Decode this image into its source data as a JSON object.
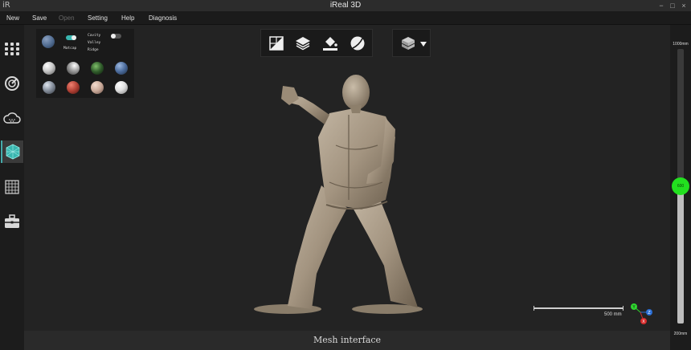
{
  "window": {
    "logo": "iR",
    "title": "iReal 3D",
    "controls": [
      "−",
      "□",
      "×"
    ]
  },
  "menu": [
    {
      "label": "New",
      "enabled": true
    },
    {
      "label": "Save",
      "enabled": true
    },
    {
      "label": "Open",
      "enabled": false
    },
    {
      "label": "Setting",
      "enabled": true
    },
    {
      "label": "Help",
      "enabled": true
    },
    {
      "label": "Diagnosis",
      "enabled": true
    }
  ],
  "sidebar": {
    "items": [
      {
        "name": "grid-dots-icon",
        "active": false
      },
      {
        "name": "scan-target-icon",
        "active": false
      },
      {
        "name": "cloud-icon",
        "active": false
      },
      {
        "name": "mesh-cube-icon",
        "active": true
      },
      {
        "name": "texture-grid-icon",
        "active": false
      },
      {
        "name": "toolbox-icon",
        "active": false
      }
    ]
  },
  "material_panel": {
    "matcap_label": "Matcap",
    "options": [
      "Cavity",
      "Valley",
      "Ridge"
    ],
    "colors": {
      "preview": "#4f6a8f",
      "matcaps": [
        "#c9c9c9",
        "#a8a8a8",
        "#2f5a2a",
        "#4a6a9a",
        "#8a93a0",
        "#b04034",
        "#c8a898",
        "#e0e0e0"
      ]
    }
  },
  "toolbar": {
    "tools": [
      "split-view-icon",
      "layers-icon",
      "paint-fill-icon",
      "sphere-shade-icon"
    ],
    "layer_dropdown_icon": "cube-layers-icon"
  },
  "slider": {
    "max_label": "1000mm",
    "min_label": "200mm",
    "value_label": "600",
    "value": 600,
    "range": [
      200,
      1000
    ]
  },
  "scale": {
    "label": "500 mm"
  },
  "axis": {
    "y": "Y",
    "z": "Z",
    "x": "X"
  },
  "status": {
    "text": "Mesh interface"
  },
  "colors": {
    "accent": "#22e01f",
    "mesh": "#a89a86"
  }
}
